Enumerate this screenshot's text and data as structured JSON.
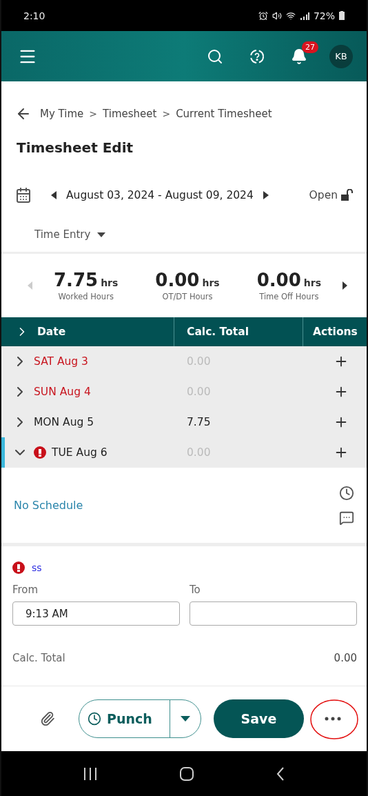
{
  "status_bar": {
    "time": "2:10",
    "battery": "72%"
  },
  "header": {
    "notification_count": "27",
    "avatar": "KB"
  },
  "breadcrumb": {
    "separator": ">",
    "items": [
      "My Time",
      "Timesheet",
      "Current Timesheet"
    ]
  },
  "title": "Timesheet Edit",
  "period": {
    "range": "August 03, 2024 - August 09, 2024",
    "status": "Open",
    "locked": false
  },
  "view_selector": "Time Entry",
  "summary": {
    "prev_disabled": true,
    "next_disabled": false,
    "items": [
      {
        "value": "7.75",
        "unit": "hrs",
        "label": "Worked Hours"
      },
      {
        "value": "0.00",
        "unit": "hrs",
        "label": "OT/DT Hours"
      },
      {
        "value": "0.00",
        "unit": "hrs",
        "label": "Time Off Hours"
      }
    ]
  },
  "table": {
    "columns": [
      "Date",
      "Calc. Total",
      "Actions"
    ],
    "rows": [
      {
        "date": "SAT Aug 3",
        "total": "0.00",
        "weekend": true,
        "zero": true,
        "expanded": false,
        "error": false,
        "selected": false
      },
      {
        "date": "SUN Aug 4",
        "total": "0.00",
        "weekend": true,
        "zero": true,
        "expanded": false,
        "error": false,
        "selected": false
      },
      {
        "date": "MON Aug 5",
        "total": "7.75",
        "weekend": false,
        "zero": false,
        "expanded": false,
        "error": false,
        "selected": false
      },
      {
        "date": "TUE Aug 6",
        "total": "0.00",
        "weekend": false,
        "zero": true,
        "expanded": true,
        "error": true,
        "selected": true
      }
    ]
  },
  "detail": {
    "schedule": "No Schedule",
    "entry": {
      "code": "ss",
      "error": true,
      "from_label": "From",
      "from_value": "9:13 AM",
      "to_label": "To"
    },
    "calc_label": "Calc. Total",
    "calc_value": "0.00"
  },
  "footer": {
    "punch": "Punch",
    "save": "Save"
  }
}
